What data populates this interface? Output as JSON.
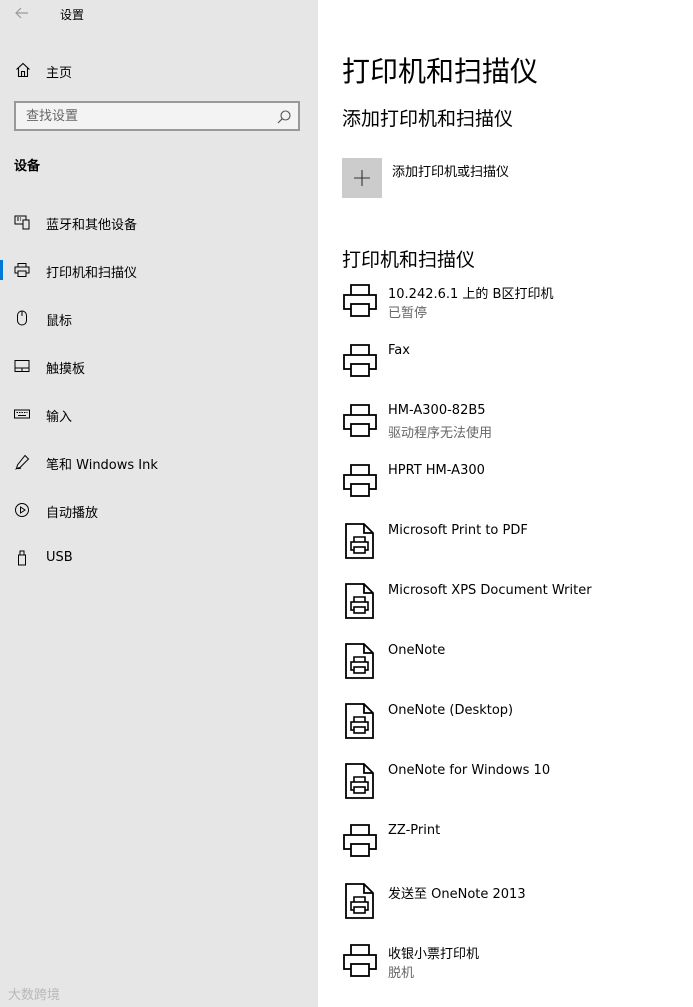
{
  "app": {
    "title": "设置"
  },
  "sidebar": {
    "home_label": "主页",
    "search_placeholder": "查找设置",
    "section_header": "设备",
    "items": [
      {
        "label": "蓝牙和其他设备",
        "icon": "bluetooth-devices-icon"
      },
      {
        "label": "打印机和扫描仪",
        "icon": "printer-icon",
        "active": true
      },
      {
        "label": "鼠标",
        "icon": "mouse-icon"
      },
      {
        "label": "触摸板",
        "icon": "touchpad-icon"
      },
      {
        "label": "输入",
        "icon": "keyboard-icon"
      },
      {
        "label": "笔和 Windows Ink",
        "icon": "pen-icon"
      },
      {
        "label": "自动播放",
        "icon": "autoplay-icon"
      },
      {
        "label": "USB",
        "icon": "usb-icon"
      }
    ]
  },
  "main": {
    "page_title": "打印机和扫描仪",
    "add_section_title": "添加打印机和扫描仪",
    "add_button_label": "添加打印机或扫描仪",
    "list_section_title": "打印机和扫描仪",
    "devices": [
      {
        "name": "10.242.6.1 上的 B区打印机",
        "status": "已暂停",
        "icon": "printer-icon"
      },
      {
        "name": "Fax",
        "status": "",
        "icon": "printer-icon"
      },
      {
        "name": "HM-A300-82B5",
        "status": "驱动程序无法使用",
        "icon": "printer-icon"
      },
      {
        "name": "HPRT HM-A300",
        "status": "",
        "icon": "printer-icon"
      },
      {
        "name": "Microsoft Print to PDF",
        "status": "",
        "icon": "document-printer-icon"
      },
      {
        "name": "Microsoft XPS Document Writer",
        "status": "",
        "icon": "document-printer-icon"
      },
      {
        "name": "OneNote",
        "status": "",
        "icon": "document-printer-icon"
      },
      {
        "name": "OneNote (Desktop)",
        "status": "",
        "icon": "document-printer-icon"
      },
      {
        "name": "OneNote for Windows 10",
        "status": "",
        "icon": "document-printer-icon"
      },
      {
        "name": "ZZ-Print",
        "status": "",
        "icon": "printer-icon"
      },
      {
        "name": "发送至 OneNote 2013",
        "status": "",
        "icon": "document-printer-icon"
      },
      {
        "name": "收银小票打印机",
        "status": "脱机",
        "icon": "printer-icon"
      }
    ]
  },
  "watermark": "大数跨境",
  "colors": {
    "sidebar_bg": "#e6e6e6",
    "accent": "#0078d7",
    "secondary_text": "#666666"
  }
}
